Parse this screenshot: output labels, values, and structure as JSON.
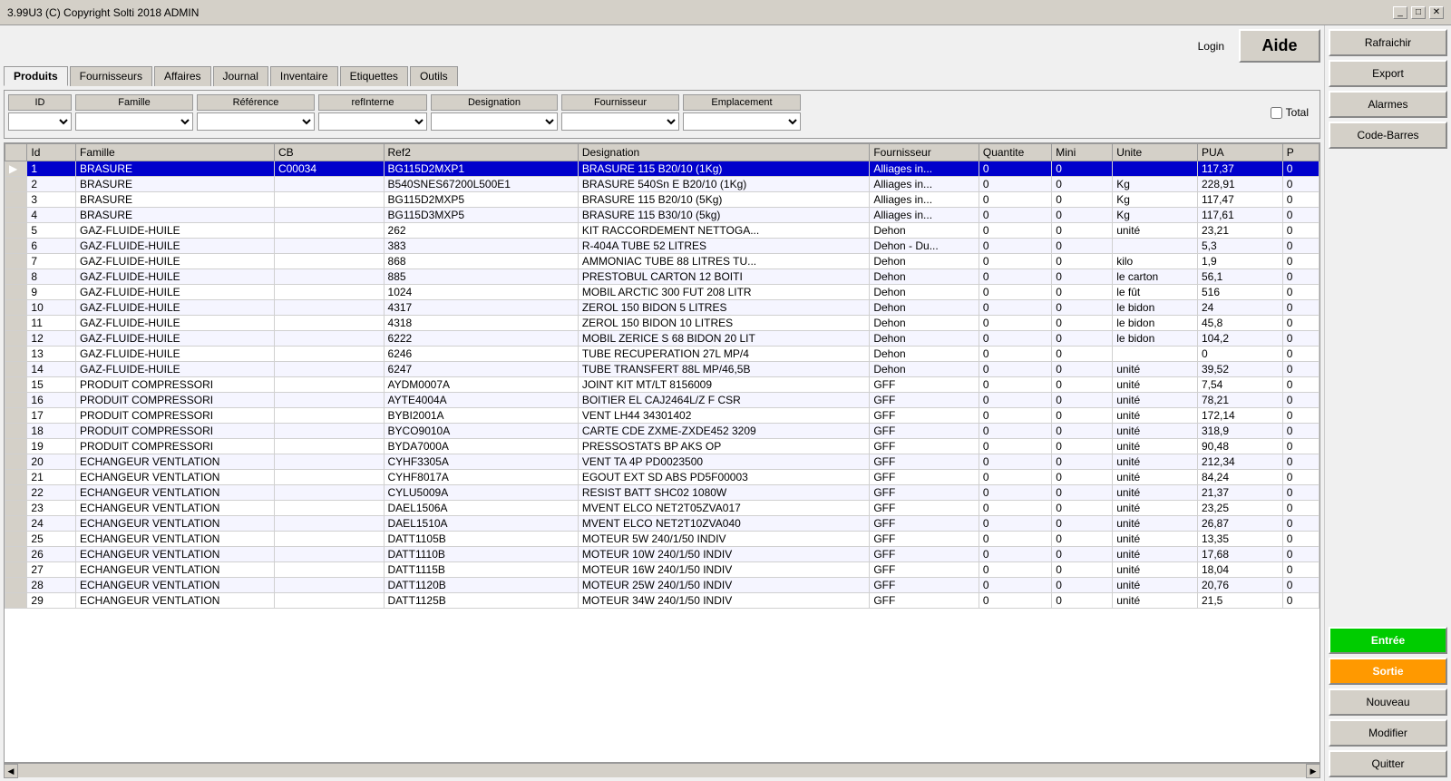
{
  "titleBar": {
    "title": "3.99U3  (C) Copyright Solti  2018  ADMIN",
    "buttons": [
      "_",
      "□",
      "✕"
    ]
  },
  "header": {
    "login": "Login",
    "aide": "Aide"
  },
  "tabs": [
    {
      "label": "Produits",
      "active": true
    },
    {
      "label": "Fournisseurs"
    },
    {
      "label": "Affaires"
    },
    {
      "label": "Journal"
    },
    {
      "label": "Inventaire"
    },
    {
      "label": "Etiquettes"
    },
    {
      "label": "Outils"
    }
  ],
  "filters": {
    "id": {
      "label": "ID"
    },
    "famille": {
      "label": "Famille"
    },
    "reference": {
      "label": "Référence"
    },
    "refInterne": {
      "label": "refInterne"
    },
    "designation": {
      "label": "Designation"
    },
    "fournisseur": {
      "label": "Fournisseur"
    },
    "emplacement": {
      "label": "Emplacement"
    },
    "total": {
      "label": "Total"
    }
  },
  "columns": [
    "Id",
    "Famille",
    "CB",
    "Ref2",
    "Designation",
    "Fournisseur",
    "Quantite",
    "Mini",
    "Unite",
    "PUA",
    "P"
  ],
  "rows": [
    {
      "id": "1",
      "famille": "BRASURE",
      "cb": "C00034",
      "ref2": "BG115D2MXP1",
      "designation": "BRASURE 115 B20/10 (1Kg)",
      "fournisseur": "Alliages in...",
      "quantite": "0",
      "mini": "0",
      "unite": "",
      "pua": "117,37",
      "p": "0",
      "selected": true
    },
    {
      "id": "2",
      "famille": "BRASURE",
      "cb": "",
      "ref2": "B540SNES67200L500E1",
      "designation": "BRASURE 540Sn E B20/10 (1Kg)",
      "fournisseur": "Alliages in...",
      "quantite": "0",
      "mini": "0",
      "unite": "Kg",
      "pua": "228,91",
      "p": "0"
    },
    {
      "id": "3",
      "famille": "BRASURE",
      "cb": "",
      "ref2": "BG115D2MXP5",
      "designation": "BRASURE 115 B20/10 (5Kg)",
      "fournisseur": "Alliages in...",
      "quantite": "0",
      "mini": "0",
      "unite": "Kg",
      "pua": "117,47",
      "p": "0"
    },
    {
      "id": "4",
      "famille": "BRASURE",
      "cb": "",
      "ref2": "BG115D3MXP5",
      "designation": "BRASURE 115 B30/10 (5kg)",
      "fournisseur": "Alliages in...",
      "quantite": "0",
      "mini": "0",
      "unite": "Kg",
      "pua": "117,61",
      "p": "0"
    },
    {
      "id": "5",
      "famille": "GAZ-FLUIDE-HUILE",
      "cb": "",
      "ref2": "262",
      "designation": "KIT RACCORDEMENT NETTOGA...",
      "fournisseur": "Dehon",
      "quantite": "0",
      "mini": "0",
      "unite": "unité",
      "pua": "23,21",
      "p": "0"
    },
    {
      "id": "6",
      "famille": "GAZ-FLUIDE-HUILE",
      "cb": "",
      "ref2": "383",
      "designation": "R-404A TUBE 52 LITRES",
      "fournisseur": "Dehon - Du...",
      "quantite": "0",
      "mini": "0",
      "unite": "",
      "pua": "5,3",
      "p": "0"
    },
    {
      "id": "7",
      "famille": "GAZ-FLUIDE-HUILE",
      "cb": "",
      "ref2": "868",
      "designation": "AMMONIAC TUBE 88 LITRES TU...",
      "fournisseur": "Dehon",
      "quantite": "0",
      "mini": "0",
      "unite": "kilo",
      "pua": "1,9",
      "p": "0"
    },
    {
      "id": "8",
      "famille": "GAZ-FLUIDE-HUILE",
      "cb": "",
      "ref2": "885",
      "designation": "PRESTOBUL  CARTON 12 BOITI",
      "fournisseur": "Dehon",
      "quantite": "0",
      "mini": "0",
      "unite": "le carton",
      "pua": "56,1",
      "p": "0"
    },
    {
      "id": "9",
      "famille": "GAZ-FLUIDE-HUILE",
      "cb": "",
      "ref2": "1024",
      "designation": "MOBIL ARCTIC 300  FUT 208 LITR",
      "fournisseur": "Dehon",
      "quantite": "0",
      "mini": "0",
      "unite": "le fût",
      "pua": "516",
      "p": "0"
    },
    {
      "id": "10",
      "famille": "GAZ-FLUIDE-HUILE",
      "cb": "",
      "ref2": "4317",
      "designation": "ZEROL 150 BIDON 5 LITRES",
      "fournisseur": "Dehon",
      "quantite": "0",
      "mini": "0",
      "unite": "le bidon",
      "pua": "24",
      "p": "0"
    },
    {
      "id": "11",
      "famille": "GAZ-FLUIDE-HUILE",
      "cb": "",
      "ref2": "4318",
      "designation": "ZEROL 150 BIDON 10 LITRES",
      "fournisseur": "Dehon",
      "quantite": "0",
      "mini": "0",
      "unite": "le bidon",
      "pua": "45,8",
      "p": "0"
    },
    {
      "id": "12",
      "famille": "GAZ-FLUIDE-HUILE",
      "cb": "",
      "ref2": "6222",
      "designation": "MOBIL ZERICE S 68 BIDON 20 LIT",
      "fournisseur": "Dehon",
      "quantite": "0",
      "mini": "0",
      "unite": "le bidon",
      "pua": "104,2",
      "p": "0"
    },
    {
      "id": "13",
      "famille": "GAZ-FLUIDE-HUILE",
      "cb": "",
      "ref2": "6246",
      "designation": "TUBE RECUPERATION 27L MP/4",
      "fournisseur": "Dehon",
      "quantite": "0",
      "mini": "0",
      "unite": "",
      "pua": "0",
      "p": "0"
    },
    {
      "id": "14",
      "famille": "GAZ-FLUIDE-HUILE",
      "cb": "",
      "ref2": "6247",
      "designation": "TUBE TRANSFERT 88L MP/46,5B",
      "fournisseur": "Dehon",
      "quantite": "0",
      "mini": "0",
      "unite": "unité",
      "pua": "39,52",
      "p": "0"
    },
    {
      "id": "15",
      "famille": "PRODUIT COMPRESSORI",
      "cb": "",
      "ref2": "AYDM0007A",
      "designation": "JOINT KIT MT/LT 8156009",
      "fournisseur": "GFF",
      "quantite": "0",
      "mini": "0",
      "unite": "unité",
      "pua": "7,54",
      "p": "0"
    },
    {
      "id": "16",
      "famille": "PRODUIT COMPRESSORI",
      "cb": "",
      "ref2": "AYTE4004A",
      "designation": "BOITIER EL CAJ2464L/Z F CSR",
      "fournisseur": "GFF",
      "quantite": "0",
      "mini": "0",
      "unite": "unité",
      "pua": "78,21",
      "p": "0"
    },
    {
      "id": "17",
      "famille": "PRODUIT COMPRESSORI",
      "cb": "",
      "ref2": "BYBI2001A",
      "designation": "VENT LH44 34301402",
      "fournisseur": "GFF",
      "quantite": "0",
      "mini": "0",
      "unite": "unité",
      "pua": "172,14",
      "p": "0"
    },
    {
      "id": "18",
      "famille": "PRODUIT COMPRESSORI",
      "cb": "",
      "ref2": "BYCO9010A",
      "designation": "CARTE CDE ZXME-ZXDE452 3209",
      "fournisseur": "GFF",
      "quantite": "0",
      "mini": "0",
      "unite": "unité",
      "pua": "318,9",
      "p": "0"
    },
    {
      "id": "19",
      "famille": "PRODUIT COMPRESSORI",
      "cb": "",
      "ref2": "BYDA7000A",
      "designation": "PRESSOSTATS BP AKS OP",
      "fournisseur": "GFF",
      "quantite": "0",
      "mini": "0",
      "unite": "unité",
      "pua": "90,48",
      "p": "0"
    },
    {
      "id": "20",
      "famille": "ECHANGEUR VENTLATION",
      "cb": "",
      "ref2": "CYHF3305A",
      "designation": "VENT TA 4P PD0023500",
      "fournisseur": "GFF",
      "quantite": "0",
      "mini": "0",
      "unite": "unité",
      "pua": "212,34",
      "p": "0"
    },
    {
      "id": "21",
      "famille": "ECHANGEUR VENTLATION",
      "cb": "",
      "ref2": "CYHF8017A",
      "designation": "EGOUT EXT SD ABS PD5F00003",
      "fournisseur": "GFF",
      "quantite": "0",
      "mini": "0",
      "unite": "unité",
      "pua": "84,24",
      "p": "0"
    },
    {
      "id": "22",
      "famille": "ECHANGEUR VENTLATION",
      "cb": "",
      "ref2": "CYLU5009A",
      "designation": "RESIST BATT SHC02 1080W",
      "fournisseur": "GFF",
      "quantite": "0",
      "mini": "0",
      "unite": "unité",
      "pua": "21,37",
      "p": "0"
    },
    {
      "id": "23",
      "famille": "ECHANGEUR VENTLATION",
      "cb": "",
      "ref2": "DAEL1506A",
      "designation": "MVENT ELCO NET2T05ZVA017",
      "fournisseur": "GFF",
      "quantite": "0",
      "mini": "0",
      "unite": "unité",
      "pua": "23,25",
      "p": "0"
    },
    {
      "id": "24",
      "famille": "ECHANGEUR VENTLATION",
      "cb": "",
      "ref2": "DAEL1510A",
      "designation": "MVENT ELCO NET2T10ZVA040",
      "fournisseur": "GFF",
      "quantite": "0",
      "mini": "0",
      "unite": "unité",
      "pua": "26,87",
      "p": "0"
    },
    {
      "id": "25",
      "famille": "ECHANGEUR VENTLATION",
      "cb": "",
      "ref2": "DATT1105B",
      "designation": "MOTEUR 5W 240/1/50 INDIV",
      "fournisseur": "GFF",
      "quantite": "0",
      "mini": "0",
      "unite": "unité",
      "pua": "13,35",
      "p": "0"
    },
    {
      "id": "26",
      "famille": "ECHANGEUR VENTLATION",
      "cb": "",
      "ref2": "DATT1110B",
      "designation": "MOTEUR 10W 240/1/50 INDIV",
      "fournisseur": "GFF",
      "quantite": "0",
      "mini": "0",
      "unite": "unité",
      "pua": "17,68",
      "p": "0"
    },
    {
      "id": "27",
      "famille": "ECHANGEUR VENTLATION",
      "cb": "",
      "ref2": "DATT1115B",
      "designation": "MOTEUR 16W 240/1/50 INDIV",
      "fournisseur": "GFF",
      "quantite": "0",
      "mini": "0",
      "unite": "unité",
      "pua": "18,04",
      "p": "0"
    },
    {
      "id": "28",
      "famille": "ECHANGEUR VENTLATION",
      "cb": "",
      "ref2": "DATT1120B",
      "designation": "MOTEUR 25W 240/1/50 INDIV",
      "fournisseur": "GFF",
      "quantite": "0",
      "mini": "0",
      "unite": "unité",
      "pua": "20,76",
      "p": "0"
    },
    {
      "id": "29",
      "famille": "ECHANGEUR VENTLATION",
      "cb": "",
      "ref2": "DATT1125B",
      "designation": "MOTEUR 34W 240/1/50 INDIV",
      "fournisseur": "GFF",
      "quantite": "0",
      "mini": "0",
      "unite": "unité",
      "pua": "21,5",
      "p": "0"
    }
  ],
  "rightPanel": {
    "rafraichir": "Rafraichir",
    "export": "Export",
    "alarmes": "Alarmes",
    "codeBarres": "Code-Barres",
    "entree": "Entrée",
    "sortie": "Sortie",
    "nouveau": "Nouveau",
    "modifier": "Modifier",
    "quitter": "Quitter"
  }
}
